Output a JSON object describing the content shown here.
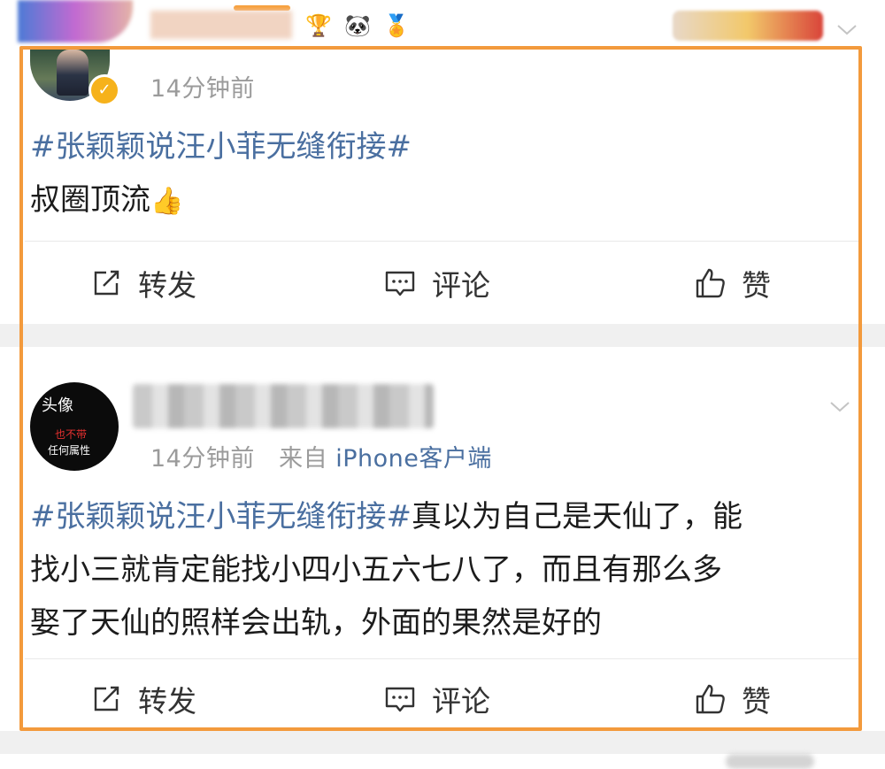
{
  "top_strip": {
    "badges": [
      "🐼",
      "🏅"
    ]
  },
  "posts": [
    {
      "time": "14分钟前",
      "source_prefix": "",
      "source": "",
      "hashtag": "#张颖颖说汪小菲无缝衔接#",
      "body": "",
      "body_line2": "叔圈顶流",
      "emoji": "👍",
      "actions": {
        "repost": "转发",
        "comment": "评论",
        "like": "赞"
      }
    },
    {
      "avatar_line1": "头像",
      "avatar_line2": "也不带",
      "avatar_line3": "任何属性",
      "time": "14分钟前",
      "source_prefix": "来自",
      "source": "iPhone客户端",
      "hashtag": "#张颖颖说汪小菲无缝衔接#",
      "body_line1": "真以为自己是天仙了，能",
      "body_line2": "找小三就肯定能找小四小五六七八了，而且有那么多",
      "body_line3": "娶了天仙的照样会出轨，外面的果然是好的",
      "actions": {
        "repost": "转发",
        "comment": "评论",
        "like": "赞"
      }
    }
  ],
  "colors": {
    "highlight_border": "#f39a3c",
    "link": "#4a6fa0",
    "meta": "#9b9b9b",
    "verified": "#f6b21b"
  },
  "icons": [
    "repost-icon",
    "comment-icon",
    "like-icon",
    "chevron-down-icon",
    "verified-icon"
  ]
}
